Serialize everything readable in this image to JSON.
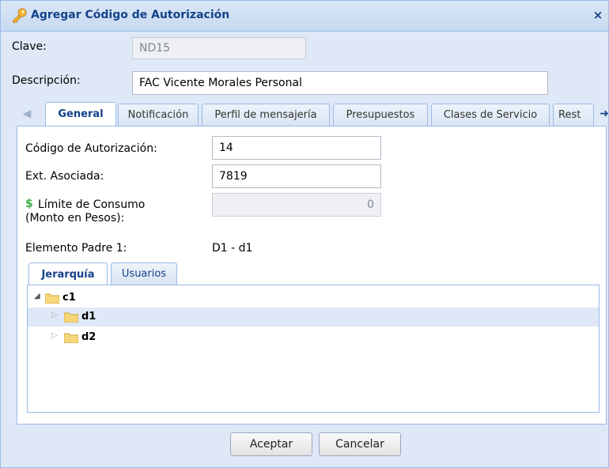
{
  "window": {
    "title": "Agregar Código de Autorización",
    "close_symbol": "×",
    "title_icon": "key-icon"
  },
  "form": {
    "clave_label": "Clave:",
    "clave_value": "ND15",
    "descripcion_label": "Descripción:",
    "descripcion_value": "FAC Vicente Morales Personal"
  },
  "tabs": [
    {
      "label": "General",
      "active": true
    },
    {
      "label": "Notificación",
      "active": false
    },
    {
      "label": "Perfil de mensajería",
      "active": false
    },
    {
      "label": "Presupuestos",
      "active": false
    },
    {
      "label": "Clases de Servicio",
      "active": false
    },
    {
      "label": "Rest",
      "active": false
    }
  ],
  "general": {
    "codigo_label": "Código de Autorización:",
    "codigo_value": "14",
    "ext_label": "Ext. Asociada:",
    "ext_value": "7819",
    "limite_label_1": "Límite de Consumo",
    "limite_label_2": "(Monto en Pesos):",
    "limite_value": "0",
    "padre_label": "Elemento Padre 1:",
    "padre_value": "D1 - d1"
  },
  "subtabs": [
    {
      "label": "Jerarquía",
      "active": true
    },
    {
      "label": "Usuarios",
      "active": false
    }
  ],
  "tree": [
    {
      "label": "c1",
      "expanded": true,
      "selected": false
    },
    {
      "label": "d1",
      "expanded": false,
      "selected": true
    },
    {
      "label": "d2",
      "expanded": false,
      "selected": false
    }
  ],
  "buttons": {
    "accept": "Aceptar",
    "cancel": "Cancelar"
  },
  "colors": {
    "header_text": "#15428b",
    "border": "#99bbe8",
    "selection": "#dfe8f6",
    "dollar": "#3fae49"
  }
}
